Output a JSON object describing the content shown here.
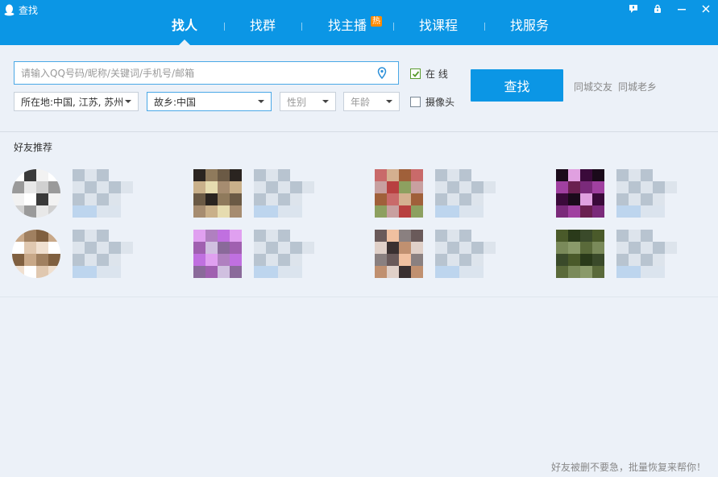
{
  "window": {
    "title": "查找",
    "controls": [
      {
        "name": "feedback-icon",
        "glyph": "▾"
      },
      {
        "name": "lock-icon",
        "glyph": "🔒"
      },
      {
        "name": "minimize-icon",
        "glyph": "—"
      },
      {
        "name": "close-icon",
        "glyph": "✕"
      }
    ]
  },
  "tabs": [
    {
      "label": "找人",
      "active": true
    },
    {
      "label": "找群",
      "active": false
    },
    {
      "label": "找主播",
      "active": false,
      "badge": "热"
    },
    {
      "label": "找课程",
      "active": false
    },
    {
      "label": "找服务",
      "active": false
    }
  ],
  "search": {
    "placeholder": "请输入QQ号码/昵称/关键词/手机号/邮箱",
    "value": "",
    "online_label": "在 线",
    "online_checked": true,
    "camera_label": "摄像头",
    "camera_checked": false,
    "button_label": "查找"
  },
  "filters": {
    "location": "所在地:中国, 江苏, 苏州",
    "hometown": "故乡:中国",
    "gender": "性别",
    "age": "年龄"
  },
  "links": {
    "same_city": "同城交友",
    "hometown_peers": "同城老乡"
  },
  "recommend": {
    "title": "好友推荐"
  },
  "footer": {
    "text": "好友被删不要急，批量恢复来帮你！"
  },
  "colors": {
    "accent": "#0b96e5",
    "background": "#ecf1f8",
    "check": "#5a9c2f",
    "hot_badge": "#ff8a00"
  }
}
